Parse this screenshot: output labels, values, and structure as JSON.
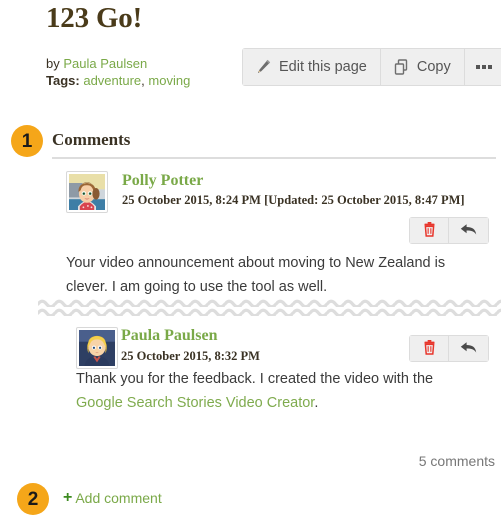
{
  "page": {
    "title": "123 Go!",
    "author_prefix": "by",
    "author": "Paula Paulsen",
    "tags_label": "Tags:",
    "tags": [
      {
        "label": "adventure"
      },
      {
        "label": "moving"
      }
    ],
    "tags_separator": ", "
  },
  "toolbar": {
    "edit_label": "Edit this page",
    "copy_label": "Copy",
    "more_label": "",
    "edit_icon": "pencil-icon",
    "copy_icon": "copy-icon",
    "more_icon": "ellipsis-icon"
  },
  "callouts": [
    {
      "number": "1"
    },
    {
      "number": "2"
    }
  ],
  "comments_section": {
    "heading": "Comments",
    "count_label": "5 comments",
    "add_comment_label": "Add comment",
    "add_comment_icon": "plus-icon"
  },
  "comments": [
    {
      "author": "Polly Potter",
      "avatar_alt": "Polly Potter avatar",
      "date": "25 October 2015, 8:24 PM [Updated: 25 October 2015, 8:47 PM]",
      "body_plain": "Your video announcement about moving to New Zealand is clever. I am going to use the tool as well.",
      "delete_icon": "trash-icon",
      "reply_icon": "reply-arrow-icon"
    },
    {
      "author": "Paula Paulsen",
      "avatar_alt": "Paula Paulsen avatar",
      "date": "25 October 2015, 8:32 PM",
      "body_prefix": "Thank you for the feedback. I created the video with the ",
      "body_link": "Google Search Stories Video Creator",
      "body_suffix": ".",
      "delete_icon": "trash-icon",
      "reply_icon": "reply-arrow-icon"
    }
  ],
  "colors": {
    "link_green": "#7aa948",
    "badge_orange": "#f5a619",
    "title_brown": "#4a3b1a",
    "trash_red": "#e8352b",
    "reply_gray": "#4a4a4a",
    "divider_gray": "#dddddd",
    "toolbar_bg": "#efefef"
  }
}
